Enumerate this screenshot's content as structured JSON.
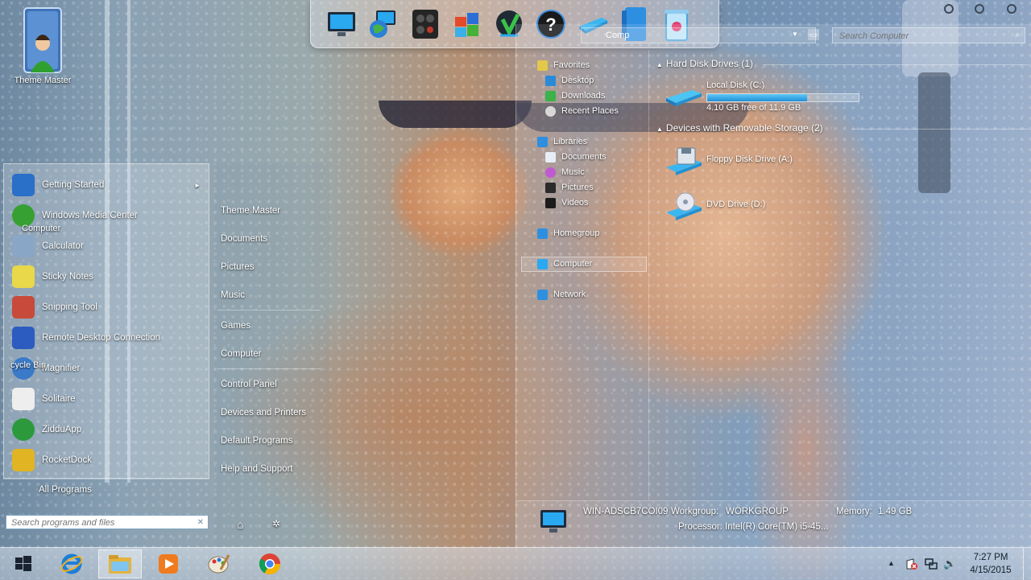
{
  "desktop": {
    "icon_label": "Theme Master"
  },
  "dock": {
    "items": [
      "monitor-icon",
      "network-globe-icon",
      "control-panel-icon",
      "windows-flag-icon",
      "download-arrow-icon",
      "help-icon",
      "drive-icon",
      "recycle-bin-icon"
    ]
  },
  "start_menu": {
    "programs": [
      {
        "label": "Getting Started",
        "icon": "monitor-icon",
        "color": "#2a6fc8",
        "arrow": "►"
      },
      {
        "label": "Windows Media Center",
        "icon": "media-center-icon",
        "color": "#36a032"
      },
      {
        "label": "Calculator",
        "icon": "calculator-icon",
        "color": "#8aa6c6"
      },
      {
        "label": "Sticky Notes",
        "icon": "sticky-notes-icon",
        "color": "#e8d84a"
      },
      {
        "label": "Snipping Tool",
        "icon": "scissors-icon",
        "color": "#c84a3a"
      },
      {
        "label": "Remote Desktop Connection",
        "icon": "remote-desktop-icon",
        "color": "#2c5cc0"
      },
      {
        "label": "Magnifier",
        "icon": "magnifier-icon",
        "color": "#3a7ac8"
      },
      {
        "label": "Solitaire",
        "icon": "cards-icon",
        "color": "#eeeeee"
      },
      {
        "label": "ZidduApp",
        "icon": "ziddu-icon",
        "color": "#2c9a3c"
      },
      {
        "label": "RocketDock",
        "icon": "rocketdock-icon",
        "color": "#e0b422"
      }
    ],
    "overlay_labels": {
      "computer": "Computer",
      "recycle_bin": "cycle Bin"
    },
    "all_programs": "All Programs",
    "search_placeholder": "Search programs and files",
    "right_items": [
      "Theme Master",
      "Documents",
      "Pictures",
      "Music",
      "Games",
      "Computer",
      "Control Panel",
      "Devices and Printers",
      "Default Programs",
      "Help and Support"
    ],
    "power": {
      "home": "⌂",
      "options": "✲"
    }
  },
  "explorer": {
    "address_partial": "Comp",
    "search_placeholder": "Search Computer",
    "nav": {
      "favorites": "Favorites",
      "desktop": "Desktop",
      "downloads": "Downloads",
      "recent_places": "Recent Places",
      "libraries": "Libraries",
      "documents": "Documents",
      "music": "Music",
      "pictures": "Pictures",
      "videos": "Videos",
      "homegroup": "Homegroup",
      "computer": "Computer",
      "network": "Network"
    },
    "hard_disk_header": "Hard Disk Drives (1)",
    "local_disk": {
      "name": "Local Disk (C:)",
      "free_text": "4.10 GB free of 11.9 GB",
      "used_fraction": 0.66
    },
    "removable_header": "Devices with Removable Storage (2)",
    "floppy": "Floppy Disk Drive (A:)",
    "dvd": "DVD Drive (D:)",
    "details": {
      "computer_name": "WIN-ADSCB7COI09",
      "workgroup_label": "Workgroup:",
      "workgroup_value": "WORKGROUP",
      "memory_label": "Memory:",
      "memory_value": "1.49 GB",
      "processor_label": "Processor:",
      "processor_value": "Intel(R) Core(TM) i5-45..."
    }
  },
  "taskbar": {
    "buttons": [
      "start-orb",
      "internet-explorer",
      "file-explorer",
      "media-player",
      "paint",
      "chrome"
    ],
    "tray": {
      "show_hidden": "▲",
      "speaker": "🔊"
    },
    "clock": {
      "time": "7:27 PM",
      "date": "4/15/2015"
    }
  }
}
